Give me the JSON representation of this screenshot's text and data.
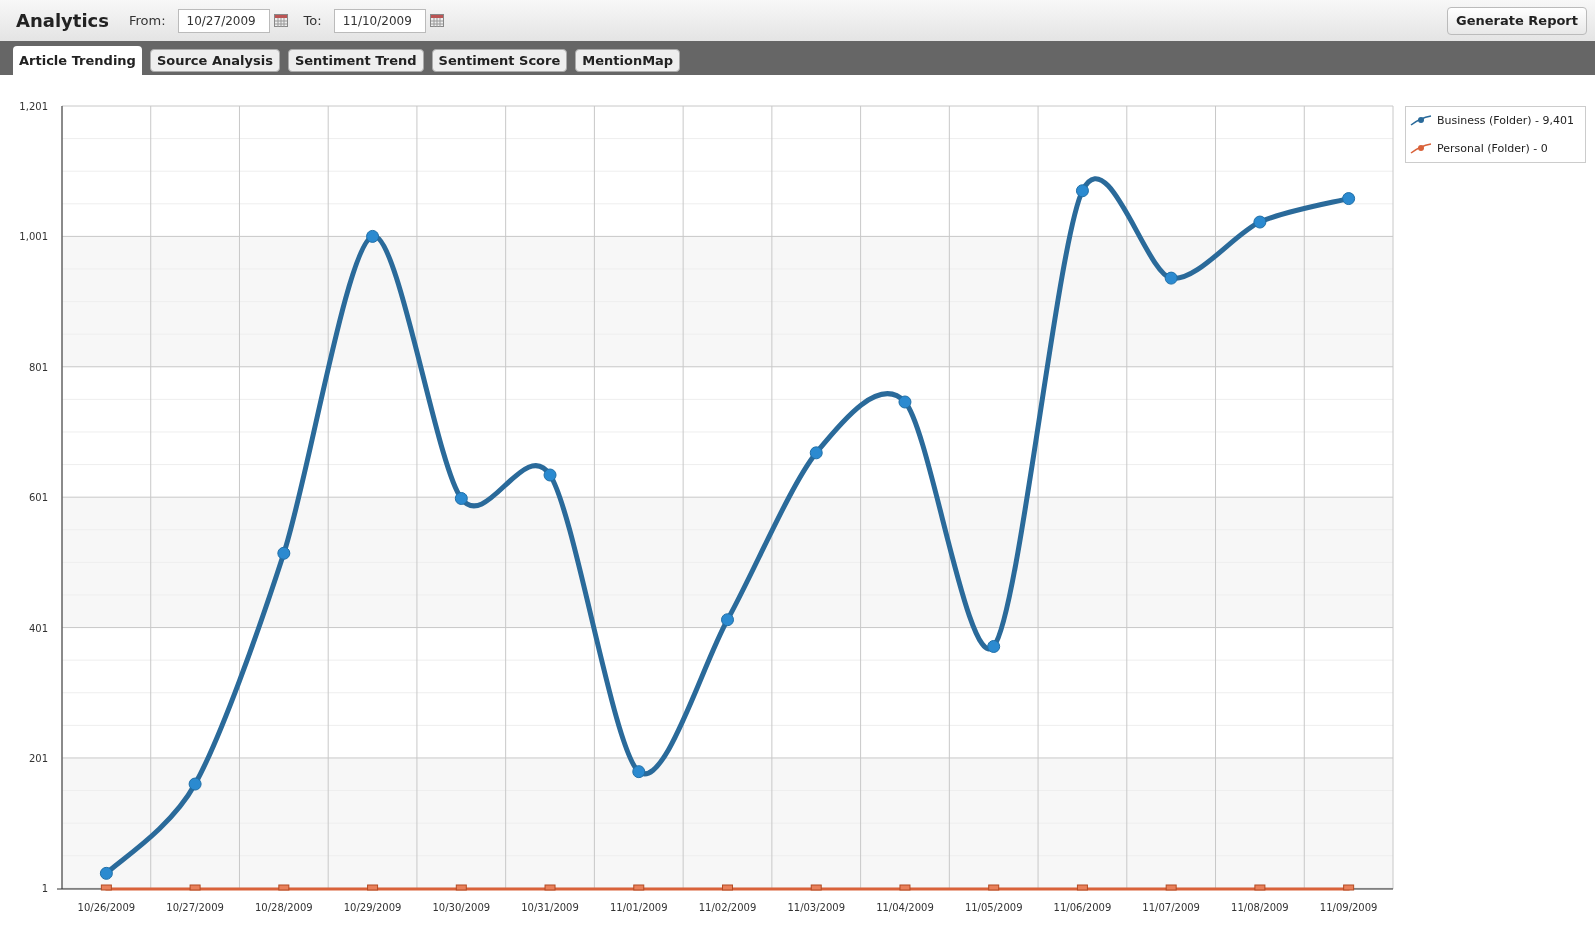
{
  "header": {
    "title": "Analytics",
    "from_label": "From:",
    "from_value": "10/27/2009",
    "to_label": "To:",
    "to_value": "11/10/2009",
    "button": "Generate Report"
  },
  "tabs": [
    {
      "label": "Article Trending",
      "selected": true
    },
    {
      "label": "Source Analysis",
      "selected": false
    },
    {
      "label": "Sentiment Trend",
      "selected": false
    },
    {
      "label": "Sentiment Score",
      "selected": false
    },
    {
      "label": "MentionMap",
      "selected": false
    }
  ],
  "chart": {
    "chart_data": {
      "type": "line",
      "grid": true,
      "legend": "right",
      "categories": [
        "10/26/2009",
        "10/27/2009",
        "10/28/2009",
        "10/29/2009",
        "10/30/2009",
        "10/31/2009",
        "11/01/2009",
        "11/02/2009",
        "11/03/2009",
        "11/04/2009",
        "11/05/2009",
        "11/06/2009",
        "11/07/2009",
        "11/08/2009",
        "11/09/2009"
      ],
      "ylim": [
        0,
        1201
      ],
      "yticks": [
        {
          "value": 1,
          "label": "1"
        },
        {
          "value": 201,
          "label": "201"
        },
        {
          "value": 401,
          "label": "401"
        },
        {
          "value": 601,
          "label": "601"
        },
        {
          "value": 801,
          "label": "801"
        },
        {
          "value": 1001,
          "label": "1,001"
        },
        {
          "value": 1201,
          "label": "1,201"
        }
      ],
      "series": [
        {
          "name": "Business (Folder) - 9,401",
          "marker": "circle",
          "color": "#2a6a9a",
          "values": [
            24,
            161,
            515,
            1001,
            599,
            635,
            180,
            413,
            669,
            747,
            372,
            1071,
            937,
            1023,
            1059
          ]
        },
        {
          "name": "Personal (Folder) - 0",
          "marker": "square",
          "color": "#d9623a",
          "values": [
            0,
            0,
            0,
            0,
            0,
            0,
            0,
            0,
            0,
            0,
            0,
            0,
            0,
            0,
            0
          ]
        }
      ]
    }
  }
}
